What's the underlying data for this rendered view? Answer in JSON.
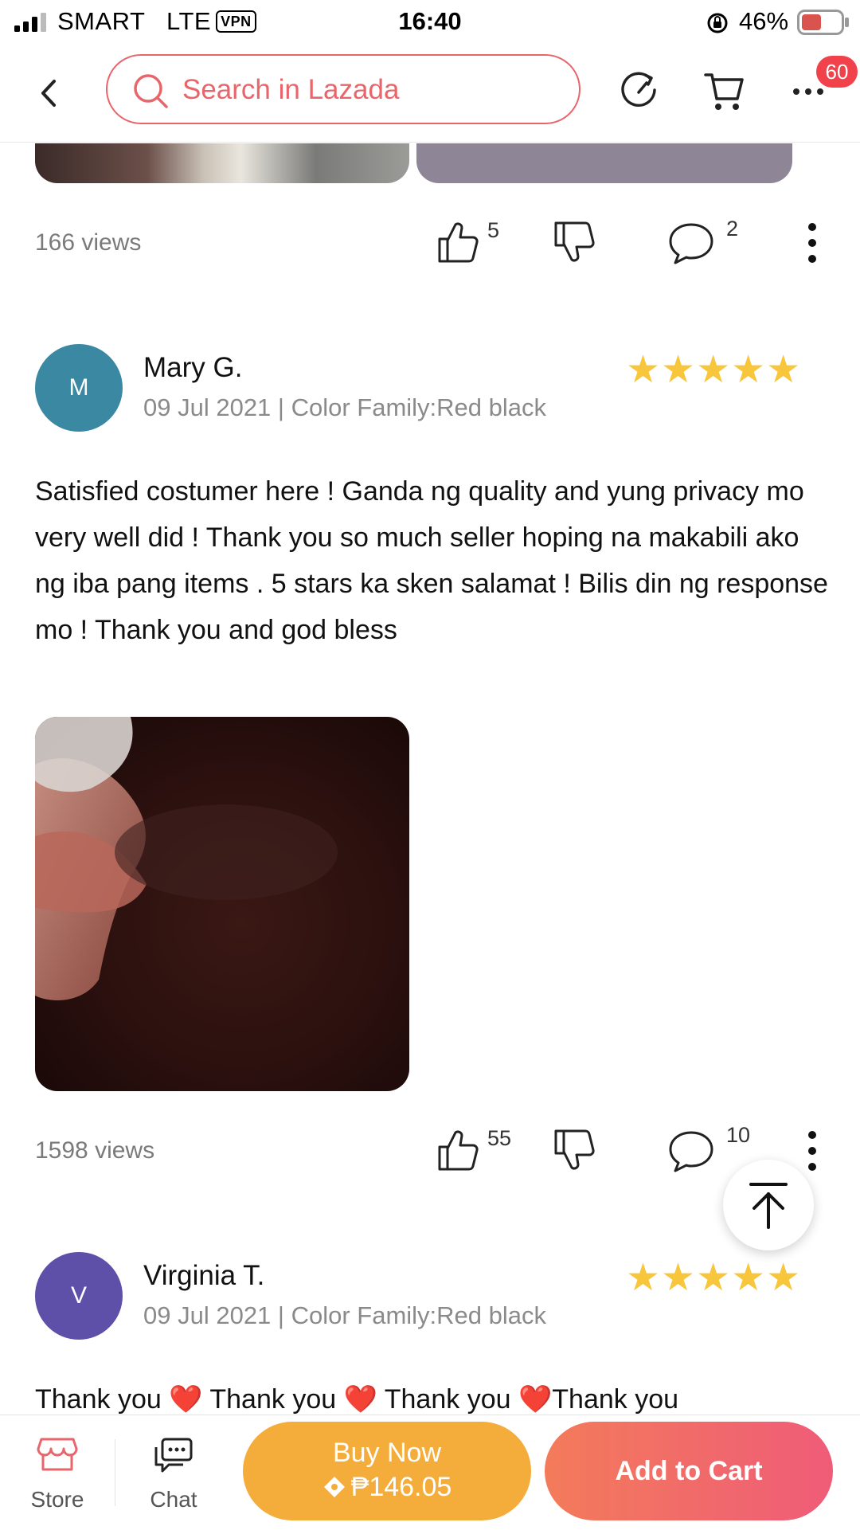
{
  "status_bar": {
    "carrier": "SMART",
    "network": "LTE",
    "vpn": "VPN",
    "time": "16:40",
    "battery": "46%"
  },
  "header": {
    "search_placeholder": "Search in Lazada",
    "badge_count": "60"
  },
  "reviews": [
    {
      "views": "166 views",
      "likes": "5",
      "comments": "2"
    },
    {
      "avatar_letter": "M",
      "avatar_color": "#3b88a3",
      "name": "Mary G.",
      "meta": "09 Jul 2021 | Color Family:Red black",
      "rating": 5,
      "stars": "★★★★★",
      "body": "Satisfied costumer here ! Ganda ng quality and yung privacy mo very well did !  Thank you so much seller hoping na makabili ako ng iba pang items . 5 stars ka sken salamat ! Bilis din ng response mo ! Thank you and god bless",
      "views": "1598 views",
      "likes": "55",
      "comments": "10"
    },
    {
      "avatar_letter": "V",
      "avatar_color": "#5e4fa8",
      "name": "Virginia T.",
      "meta": "09 Jul 2021 | Color Family:Red black",
      "rating": 5,
      "stars": "★★★★★",
      "body": "Thank you ❤️ Thank you ❤️ Thank you ❤️Thank you"
    }
  ],
  "bottom_bar": {
    "store_label": "Store",
    "chat_label": "Chat",
    "buy_now_label": "Buy Now",
    "buy_now_price": "₱146.05",
    "add_to_cart_label": "Add to Cart"
  },
  "colors": {
    "accent": "#e8656b",
    "star": "#f8c63d",
    "buy_now": "#f4ad3a",
    "add_to_cart": "#ef5c78",
    "badge": "#f1414b"
  }
}
